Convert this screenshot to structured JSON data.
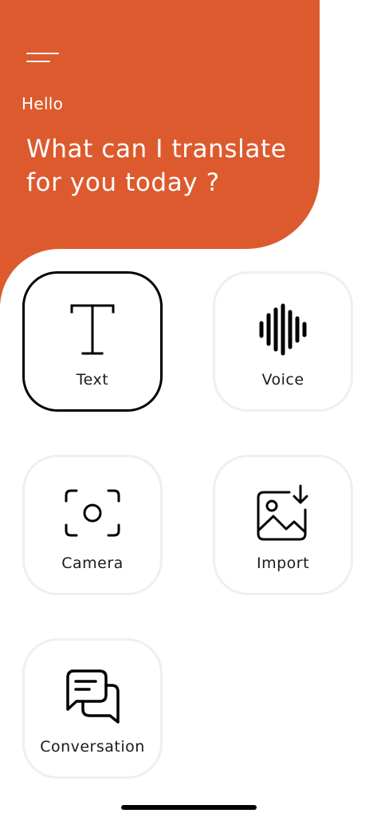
{
  "header": {
    "greeting": "Hello",
    "headline": "What can I translate for you today ?",
    "menu_icon": "hamburger-menu-icon"
  },
  "modes": [
    {
      "label": "Text",
      "icon": "text-icon",
      "selected": true
    },
    {
      "label": "Voice",
      "icon": "waveform-icon",
      "selected": false
    },
    {
      "label": "Camera",
      "icon": "camera-scan-icon",
      "selected": false
    },
    {
      "label": "Import",
      "icon": "image-import-icon",
      "selected": false
    },
    {
      "label": "Conversation",
      "icon": "chat-bubbles-icon",
      "selected": false
    }
  ],
  "colors": {
    "accent": "#dd5a2e",
    "tile_border": "#efeff1",
    "selected_border": "#000000"
  }
}
